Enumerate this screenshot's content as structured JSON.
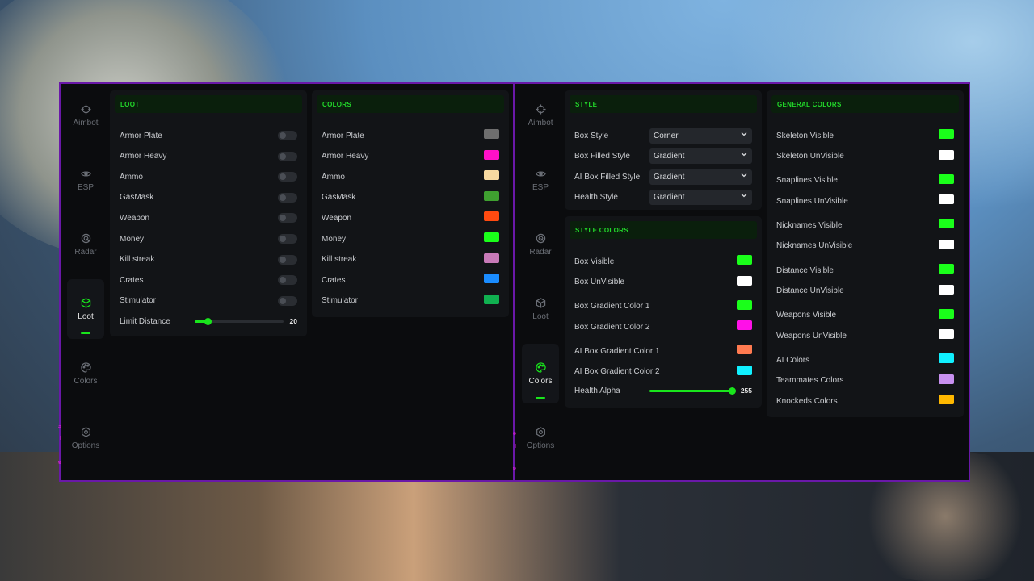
{
  "nav": [
    {
      "id": "aimbot",
      "label": "Aimbot",
      "icon": "crosshair-icon"
    },
    {
      "id": "esp",
      "label": "ESP",
      "icon": "eye-icon"
    },
    {
      "id": "radar",
      "label": "Radar",
      "icon": "radar-icon"
    },
    {
      "id": "loot",
      "label": "Loot",
      "icon": "box-icon"
    },
    {
      "id": "colors",
      "label": "Colors",
      "icon": "palette-icon"
    },
    {
      "id": "options",
      "label": "Options",
      "icon": "gear-icon"
    }
  ],
  "left_window": {
    "active_tab": "Loot",
    "loot": {
      "title": "LOOT",
      "items": [
        "Armor Plate",
        "Armor Heavy",
        "Ammo",
        "GasMask",
        "Weapon",
        "Money",
        "Kill streak",
        "Crates",
        "Stimulator"
      ],
      "limit_label": "Limit Distance",
      "limit_value": "20",
      "limit_fraction": 0.15
    },
    "colors": {
      "title": "COLORS",
      "items": [
        {
          "label": "Armor Plate",
          "color": "#6e6e6e"
        },
        {
          "label": "Armor Heavy",
          "color": "#ff10c8"
        },
        {
          "label": "Ammo",
          "color": "#f7d9a0"
        },
        {
          "label": "GasMask",
          "color": "#3fa030"
        },
        {
          "label": "Weapon",
          "color": "#ff4a10"
        },
        {
          "label": "Money",
          "color": "#1aff1a"
        },
        {
          "label": "Kill streak",
          "color": "#c87ab8"
        },
        {
          "label": "Crates",
          "color": "#1a8cff"
        },
        {
          "label": "Stimulator",
          "color": "#10b050"
        }
      ]
    }
  },
  "right_window": {
    "active_tab": "Colors",
    "style": {
      "title": "STYLE",
      "rows": [
        {
          "label": "Box Style",
          "value": "Corner"
        },
        {
          "label": "Box Filled Style",
          "value": "Gradient"
        },
        {
          "label": "AI Box Filled Style",
          "value": "Gradient"
        },
        {
          "label": "Health Style",
          "value": "Gradient"
        }
      ]
    },
    "style_colors": {
      "title": "STYLE COLORS",
      "items": [
        {
          "label": "Box Visible",
          "color": "#1aff1a"
        },
        {
          "label": "Box UnVisible",
          "color": "#ffffff"
        },
        {
          "label": "Box Gradient Color 1",
          "color": "#1aff1a"
        },
        {
          "label": "Box Gradient Color 2",
          "color": "#ff10e8"
        },
        {
          "label": "AI Box Gradient Color 1",
          "color": "#ff7a50"
        },
        {
          "label": "AI Box Gradient Color 2",
          "color": "#10f0ff"
        }
      ],
      "health_label": "Health Alpha",
      "health_value": "255",
      "health_fraction": 1.0
    },
    "general_colors": {
      "title": "GENERAL COLORS",
      "items": [
        {
          "label": "Skeleton Visible",
          "color": "#1aff1a"
        },
        {
          "label": "Skeleton UnVisible",
          "color": "#ffffff"
        },
        {
          "label": "Snaplines Visible",
          "color": "#1aff1a"
        },
        {
          "label": "Snaplines UnVisible",
          "color": "#ffffff"
        },
        {
          "label": "Nicknames Visible",
          "color": "#1aff1a"
        },
        {
          "label": "Nicknames UnVisible",
          "color": "#ffffff"
        },
        {
          "label": "Distance Visible",
          "color": "#1aff1a"
        },
        {
          "label": "Distance UnVisible",
          "color": "#ffffff"
        },
        {
          "label": "Weapons Visible",
          "color": "#1aff1a"
        },
        {
          "label": "Weapons UnVisible",
          "color": "#ffffff"
        },
        {
          "label": "AI Colors",
          "color": "#10f0ff"
        },
        {
          "label": "Teammates Colors",
          "color": "#c890f0"
        },
        {
          "label": "Knockeds Colors",
          "color": "#ffb800"
        }
      ]
    }
  },
  "theme": {
    "accent": "#19e51c",
    "border": "#6a18a8"
  }
}
